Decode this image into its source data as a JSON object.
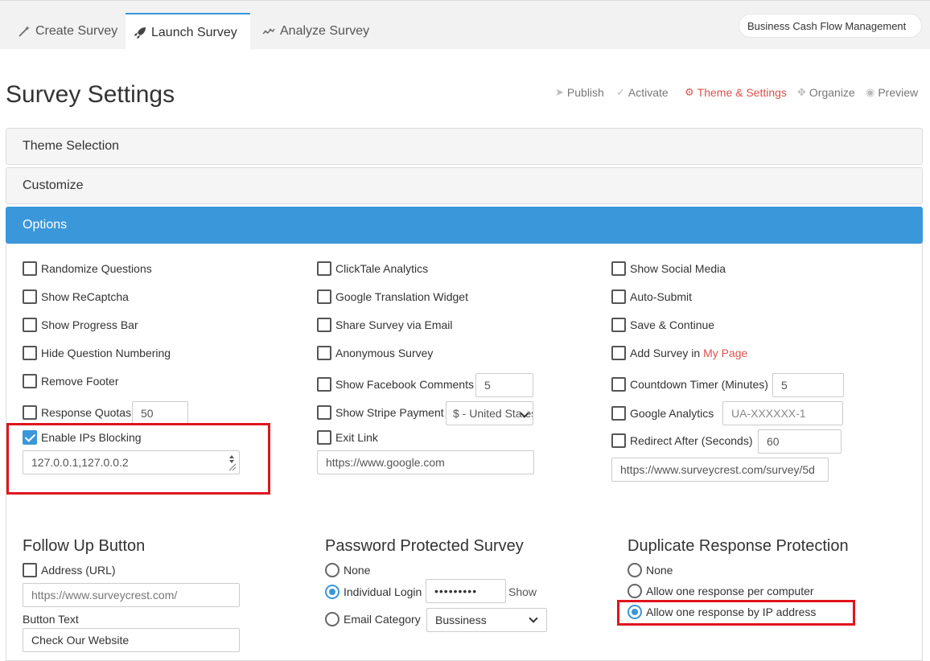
{
  "tabs": [
    {
      "label": "Create Survey",
      "icon": "magic-wand-icon"
    },
    {
      "label": "Launch Survey",
      "icon": "rocket-icon"
    },
    {
      "label": "Analyze Survey",
      "icon": "line-chart-icon"
    }
  ],
  "survey_name": "Business Cash Flow Management",
  "page_title": "Survey Settings",
  "actions": [
    {
      "label": "Publish",
      "icon": "paper-plane-icon"
    },
    {
      "label": "Activate",
      "icon": "check-icon"
    },
    {
      "label": "Theme & Settings",
      "icon": "gear-icon"
    },
    {
      "label": "Organize",
      "icon": "move-icon"
    },
    {
      "label": "Preview",
      "icon": "eye-icon"
    }
  ],
  "accordion": {
    "theme": "Theme Selection",
    "customize": "Customize",
    "options": "Options"
  },
  "options": {
    "col1": {
      "randomize": "Randomize Questions",
      "recaptcha": "Show ReCaptcha",
      "progress": "Show Progress Bar",
      "hide_numbering": "Hide Question Numbering",
      "remove_footer": "Remove Footer",
      "quotas": "Response Quotas",
      "quotas_value": "50",
      "ip_blocking": "Enable IPs Blocking",
      "ip_list": "127.0.0.1,127.0.0.2"
    },
    "col2": {
      "clicktale": "ClickTale Analytics",
      "translation": "Google Translation Widget",
      "share_email": "Share Survey via Email",
      "anonymous": "Anonymous Survey",
      "fb_comments": "Show Facebook Comments",
      "fb_comments_value": "5",
      "stripe": "Show Stripe Payment",
      "stripe_currency": "$ - United States",
      "exit_link": "Exit Link",
      "exit_link_value": "https://www.google.com"
    },
    "col3": {
      "social": "Show Social Media",
      "auto_submit": "Auto-Submit",
      "save_continue": "Save & Continue",
      "add_survey_prefix": "Add Survey in ",
      "add_survey_link": "My Page",
      "countdown": "Countdown Timer (Minutes)",
      "countdown_value": "5",
      "ga": "Google Analytics",
      "ga_placeholder": "UA-XXXXXX-1",
      "redirect": "Redirect After (Seconds)",
      "redirect_value": "60",
      "redirect_url": "https://www.surveycrest.com/survey/5d"
    }
  },
  "follow_up": {
    "title": "Follow Up Button",
    "address_label": "Address (URL)",
    "address_placeholder": "https://www.surveycrest.com/",
    "button_text_label": "Button Text",
    "button_text_value": "Check Our Website"
  },
  "password": {
    "title": "Password Protected Survey",
    "none": "None",
    "individual": "Individual Login",
    "password_mask": "•••••••••",
    "show": "Show",
    "email_category": "Email Category",
    "category_value": "Bussiness"
  },
  "duplicate": {
    "title": "Duplicate Response Protection",
    "none": "None",
    "per_computer": "Allow one response per computer",
    "by_ip": "Allow one response by IP address"
  },
  "colors": {
    "accent": "#3a97d9",
    "highlight": "#e0141e",
    "active_link": "#d9534f"
  }
}
